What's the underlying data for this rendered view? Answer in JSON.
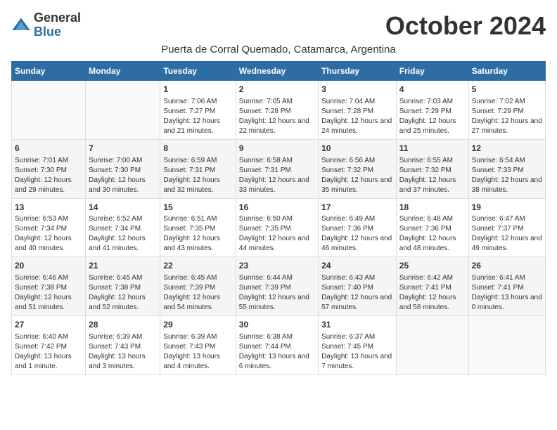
{
  "header": {
    "logo_general": "General",
    "logo_blue": "Blue",
    "month_title": "October 2024",
    "subtitle": "Puerta de Corral Quemado, Catamarca, Argentina"
  },
  "weekdays": [
    "Sunday",
    "Monday",
    "Tuesday",
    "Wednesday",
    "Thursday",
    "Friday",
    "Saturday"
  ],
  "weeks": [
    [
      {
        "day": "",
        "empty": true
      },
      {
        "day": "",
        "empty": true
      },
      {
        "day": "1",
        "sunrise": "Sunrise: 7:06 AM",
        "sunset": "Sunset: 7:27 PM",
        "daylight": "Daylight: 12 hours and 21 minutes."
      },
      {
        "day": "2",
        "sunrise": "Sunrise: 7:05 AM",
        "sunset": "Sunset: 7:28 PM",
        "daylight": "Daylight: 12 hours and 22 minutes."
      },
      {
        "day": "3",
        "sunrise": "Sunrise: 7:04 AM",
        "sunset": "Sunset: 7:28 PM",
        "daylight": "Daylight: 12 hours and 24 minutes."
      },
      {
        "day": "4",
        "sunrise": "Sunrise: 7:03 AM",
        "sunset": "Sunset: 7:29 PM",
        "daylight": "Daylight: 12 hours and 25 minutes."
      },
      {
        "day": "5",
        "sunrise": "Sunrise: 7:02 AM",
        "sunset": "Sunset: 7:29 PM",
        "daylight": "Daylight: 12 hours and 27 minutes."
      }
    ],
    [
      {
        "day": "6",
        "sunrise": "Sunrise: 7:01 AM",
        "sunset": "Sunset: 7:30 PM",
        "daylight": "Daylight: 12 hours and 29 minutes."
      },
      {
        "day": "7",
        "sunrise": "Sunrise: 7:00 AM",
        "sunset": "Sunset: 7:30 PM",
        "daylight": "Daylight: 12 hours and 30 minutes."
      },
      {
        "day": "8",
        "sunrise": "Sunrise: 6:59 AM",
        "sunset": "Sunset: 7:31 PM",
        "daylight": "Daylight: 12 hours and 32 minutes."
      },
      {
        "day": "9",
        "sunrise": "Sunrise: 6:58 AM",
        "sunset": "Sunset: 7:31 PM",
        "daylight": "Daylight: 12 hours and 33 minutes."
      },
      {
        "day": "10",
        "sunrise": "Sunrise: 6:56 AM",
        "sunset": "Sunset: 7:32 PM",
        "daylight": "Daylight: 12 hours and 35 minutes."
      },
      {
        "day": "11",
        "sunrise": "Sunrise: 6:55 AM",
        "sunset": "Sunset: 7:32 PM",
        "daylight": "Daylight: 12 hours and 37 minutes."
      },
      {
        "day": "12",
        "sunrise": "Sunrise: 6:54 AM",
        "sunset": "Sunset: 7:33 PM",
        "daylight": "Daylight: 12 hours and 38 minutes."
      }
    ],
    [
      {
        "day": "13",
        "sunrise": "Sunrise: 6:53 AM",
        "sunset": "Sunset: 7:34 PM",
        "daylight": "Daylight: 12 hours and 40 minutes."
      },
      {
        "day": "14",
        "sunrise": "Sunrise: 6:52 AM",
        "sunset": "Sunset: 7:34 PM",
        "daylight": "Daylight: 12 hours and 41 minutes."
      },
      {
        "day": "15",
        "sunrise": "Sunrise: 6:51 AM",
        "sunset": "Sunset: 7:35 PM",
        "daylight": "Daylight: 12 hours and 43 minutes."
      },
      {
        "day": "16",
        "sunrise": "Sunrise: 6:50 AM",
        "sunset": "Sunset: 7:35 PM",
        "daylight": "Daylight: 12 hours and 44 minutes."
      },
      {
        "day": "17",
        "sunrise": "Sunrise: 6:49 AM",
        "sunset": "Sunset: 7:36 PM",
        "daylight": "Daylight: 12 hours and 46 minutes."
      },
      {
        "day": "18",
        "sunrise": "Sunrise: 6:48 AM",
        "sunset": "Sunset: 7:36 PM",
        "daylight": "Daylight: 12 hours and 48 minutes."
      },
      {
        "day": "19",
        "sunrise": "Sunrise: 6:47 AM",
        "sunset": "Sunset: 7:37 PM",
        "daylight": "Daylight: 12 hours and 49 minutes."
      }
    ],
    [
      {
        "day": "20",
        "sunrise": "Sunrise: 6:46 AM",
        "sunset": "Sunset: 7:38 PM",
        "daylight": "Daylight: 12 hours and 51 minutes."
      },
      {
        "day": "21",
        "sunrise": "Sunrise: 6:45 AM",
        "sunset": "Sunset: 7:38 PM",
        "daylight": "Daylight: 12 hours and 52 minutes."
      },
      {
        "day": "22",
        "sunrise": "Sunrise: 6:45 AM",
        "sunset": "Sunset: 7:39 PM",
        "daylight": "Daylight: 12 hours and 54 minutes."
      },
      {
        "day": "23",
        "sunrise": "Sunrise: 6:44 AM",
        "sunset": "Sunset: 7:39 PM",
        "daylight": "Daylight: 12 hours and 55 minutes."
      },
      {
        "day": "24",
        "sunrise": "Sunrise: 6:43 AM",
        "sunset": "Sunset: 7:40 PM",
        "daylight": "Daylight: 12 hours and 57 minutes."
      },
      {
        "day": "25",
        "sunrise": "Sunrise: 6:42 AM",
        "sunset": "Sunset: 7:41 PM",
        "daylight": "Daylight: 12 hours and 58 minutes."
      },
      {
        "day": "26",
        "sunrise": "Sunrise: 6:41 AM",
        "sunset": "Sunset: 7:41 PM",
        "daylight": "Daylight: 13 hours and 0 minutes."
      }
    ],
    [
      {
        "day": "27",
        "sunrise": "Sunrise: 6:40 AM",
        "sunset": "Sunset: 7:42 PM",
        "daylight": "Daylight: 13 hours and 1 minute."
      },
      {
        "day": "28",
        "sunrise": "Sunrise: 6:39 AM",
        "sunset": "Sunset: 7:43 PM",
        "daylight": "Daylight: 13 hours and 3 minutes."
      },
      {
        "day": "29",
        "sunrise": "Sunrise: 6:39 AM",
        "sunset": "Sunset: 7:43 PM",
        "daylight": "Daylight: 13 hours and 4 minutes."
      },
      {
        "day": "30",
        "sunrise": "Sunrise: 6:38 AM",
        "sunset": "Sunset: 7:44 PM",
        "daylight": "Daylight: 13 hours and 6 minutes."
      },
      {
        "day": "31",
        "sunrise": "Sunrise: 6:37 AM",
        "sunset": "Sunset: 7:45 PM",
        "daylight": "Daylight: 13 hours and 7 minutes."
      },
      {
        "day": "",
        "empty": true
      },
      {
        "day": "",
        "empty": true
      }
    ]
  ]
}
